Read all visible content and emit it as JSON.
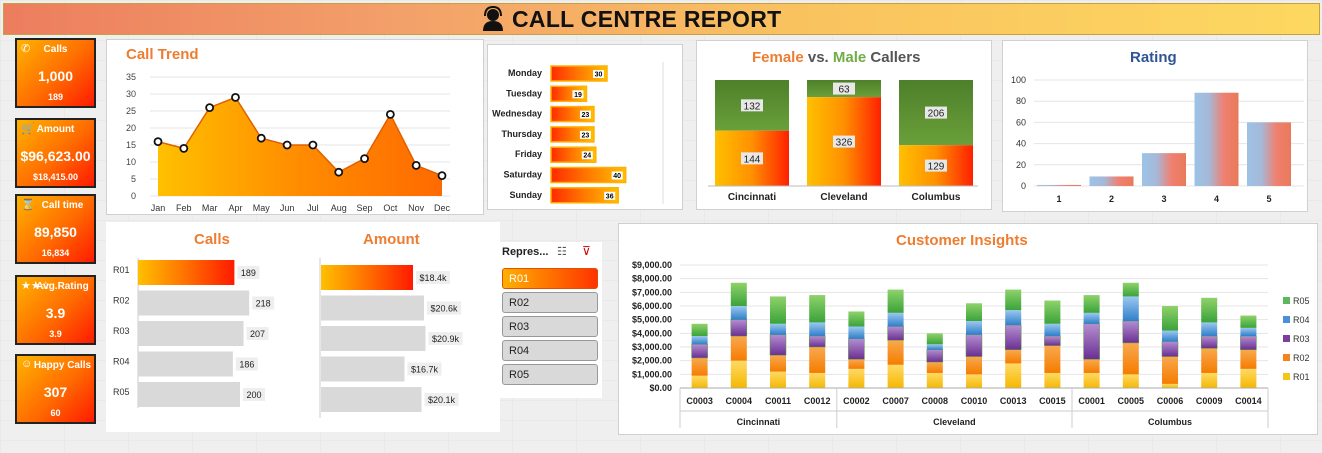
{
  "title": "CALL CENTRE REPORT",
  "kpis": [
    {
      "label": "Calls",
      "value": "1,000",
      "sub": "189",
      "icon": "phone-icon",
      "glyph": "✆"
    },
    {
      "label": "Amount",
      "value": "$96,623.00",
      "sub": "$18,415.00",
      "icon": "cart-icon",
      "glyph": "🛒"
    },
    {
      "label": "Call time",
      "value": "89,850",
      "sub": "16,834",
      "icon": "clock-icon",
      "glyph": "⌛"
    },
    {
      "label": "Avg.Rating",
      "value": "3.9",
      "sub": "3.9",
      "icon": "stars-icon",
      "glyph": "★★☆"
    },
    {
      "label": "Happy Calls",
      "value": "307",
      "sub": "60",
      "icon": "smiley-icon",
      "glyph": "☺"
    }
  ],
  "slicer": {
    "header": "Repres...",
    "items": [
      "R01",
      "R02",
      "R03",
      "R04",
      "R05"
    ],
    "selected": "R01"
  },
  "colors": {
    "orange": "#ed7d31",
    "green": "#70ad47",
    "blue": "#2f5597",
    "r05": "#5cb85c",
    "r04": "#4a90d9",
    "r03": "#7b3fa0",
    "r02": "#f5821f",
    "r01": "#f5c518"
  },
  "chart_data": [
    {
      "type": "area",
      "id": "call-trend",
      "title": "Call Trend",
      "categories": [
        "Jan",
        "Feb",
        "Mar",
        "Apr",
        "May",
        "Jun",
        "Jul",
        "Aug",
        "Sep",
        "Oct",
        "Nov",
        "Dec"
      ],
      "values": [
        16,
        14,
        26,
        29,
        17,
        15,
        15,
        7,
        11,
        24,
        9,
        6
      ],
      "ylim": [
        0,
        35
      ],
      "yticks": [
        0,
        5,
        10,
        15,
        20,
        25,
        30,
        35
      ]
    },
    {
      "type": "bar",
      "id": "weekday",
      "orientation": "horizontal",
      "categories": [
        "Monday",
        "Tuesday",
        "Wednesday",
        "Thursday",
        "Friday",
        "Saturday",
        "Sunday"
      ],
      "values": [
        30,
        19,
        23,
        23,
        24,
        40,
        36
      ],
      "labels": [
        "30",
        "19",
        "23",
        "23",
        "24",
        "40",
        "36"
      ],
      "xlim": [
        0,
        60
      ]
    },
    {
      "type": "bar",
      "id": "gender",
      "stacked": true,
      "title_parts": [
        "Female",
        " vs. ",
        "Male",
        " Callers"
      ],
      "categories": [
        "Cincinnati",
        "Cleveland",
        "Columbus"
      ],
      "series": [
        {
          "values": [
            144,
            326,
            129
          ]
        },
        {
          "values": [
            132,
            63,
            206
          ]
        }
      ]
    },
    {
      "type": "bar",
      "id": "rating",
      "title": "Rating",
      "categories": [
        "1",
        "2",
        "3",
        "4",
        "5"
      ],
      "values": [
        1,
        9,
        31,
        88,
        60
      ],
      "ylim": [
        0,
        100
      ],
      "yticks": [
        0,
        20,
        40,
        60,
        80,
        100
      ]
    },
    {
      "type": "bar",
      "id": "calls-rep",
      "orientation": "horizontal",
      "title": "Calls",
      "categories": [
        "R01",
        "R02",
        "R03",
        "R04",
        "R05"
      ],
      "values": [
        189,
        218,
        207,
        186,
        200
      ],
      "labels": [
        "189",
        "218",
        "207",
        "186",
        "200"
      ],
      "xlim": [
        0,
        250
      ]
    },
    {
      "type": "bar",
      "id": "amount-rep",
      "orientation": "horizontal",
      "title": "Amount",
      "values": [
        18.4,
        20.6,
        20.9,
        16.7,
        20.1
      ],
      "labels": [
        "$18.4k",
        "$20.6k",
        "$20.9k",
        "$16.7k",
        "$20.1k"
      ],
      "xlim": [
        0,
        24
      ]
    },
    {
      "type": "bar",
      "id": "customer",
      "stacked": true,
      "title": "Customer Insights",
      "categories": [
        "C0003",
        "C0004",
        "C0011",
        "C0012",
        "C0002",
        "C0007",
        "C0008",
        "C0010",
        "C0013",
        "C0015",
        "C0001",
        "C0005",
        "C0006",
        "C0009",
        "C0014"
      ],
      "groups": [
        {
          "name": "Cincinnati",
          "count": 4
        },
        {
          "name": "Cleveland",
          "count": 6
        },
        {
          "name": "Columbus",
          "count": 5
        }
      ],
      "series": [
        {
          "name": "R01",
          "values": [
            900,
            2000,
            1200,
            1100,
            1400,
            1700,
            1100,
            1000,
            1800,
            1100,
            1100,
            1000,
            300,
            1100,
            1400
          ]
        },
        {
          "name": "R02",
          "values": [
            1300,
            1800,
            1200,
            1900,
            700,
            1800,
            800,
            1300,
            1000,
            2000,
            1000,
            2300,
            2000,
            1800,
            1400
          ]
        },
        {
          "name": "R03",
          "values": [
            1000,
            1200,
            1500,
            800,
            1500,
            1000,
            900,
            1600,
            1800,
            700,
            2600,
            1600,
            1100,
            900,
            1000
          ]
        },
        {
          "name": "R04",
          "values": [
            600,
            1000,
            800,
            1000,
            900,
            1000,
            400,
            1000,
            1100,
            900,
            800,
            1800,
            800,
            1000,
            600
          ]
        },
        {
          "name": "R05",
          "values": [
            900,
            1700,
            2000,
            2000,
            1100,
            1700,
            800,
            1300,
            1500,
            1700,
            1300,
            1000,
            1800,
            1800,
            900
          ]
        }
      ],
      "ylim": [
        0,
        9000
      ],
      "yticks": [
        "$0.00",
        "$1,000.00",
        "$2,000.00",
        "$3,000.00",
        "$4,000.00",
        "$5,000.00",
        "$6,000.00",
        "$7,000.00",
        "$8,000.00",
        "$9,000.00"
      ]
    }
  ]
}
